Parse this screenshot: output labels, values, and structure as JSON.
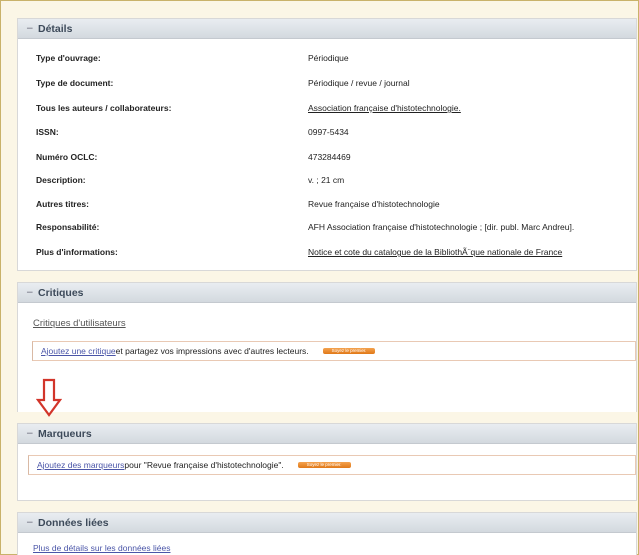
{
  "details": {
    "title": "Détails",
    "toggle": "−",
    "rows": [
      {
        "label": "Type d'ouvrage:",
        "value": "Périodique"
      },
      {
        "label": "Type de document:",
        "value": "Périodique / revue / journal"
      },
      {
        "label": "Tous les auteurs / collaborateurs:",
        "value": "Association française d'histotechnologie."
      },
      {
        "label": "ISSN:",
        "value": "0997-5434"
      },
      {
        "label": "Numéro OCLC:",
        "value": "473284469"
      },
      {
        "label": "Description:",
        "value": "v. ; 21 cm"
      },
      {
        "label": "Autres titres:",
        "value": "Revue française d'histotechnologie"
      },
      {
        "label": "Responsabilité:",
        "value": "AFH Association française d'histotechnologie ; [dir. publ. Marc Andreu]."
      },
      {
        "label": "Plus d'informations:",
        "value": "Notice et cote du catalogue de la BibliothÃ¨que nationale de France"
      }
    ]
  },
  "critiques": {
    "title": "Critiques",
    "toggle": "−",
    "subheading": "Critiques d'utilisateurs",
    "add_link": "Ajoutez une critique",
    "add_text": " et partagez vos impressions avec d'autres lecteurs.",
    "badge": "Soyez le premier."
  },
  "marqueurs": {
    "title": "Marqueurs",
    "toggle": "−",
    "add_link": "Ajoutez des marqueurs",
    "add_text": " pour \"Revue française d'histotechnologie\".",
    "badge": "Soyez le premier."
  },
  "donnees": {
    "title": "Données liées",
    "toggle": "−",
    "link": "Plus de détails sur les données liées"
  },
  "colors": {
    "accent": "#e07818",
    "arrow": "#d2352a",
    "link": "#4a55a8"
  },
  "icons": {
    "pointer_arrow": "arrow-down-icon"
  }
}
